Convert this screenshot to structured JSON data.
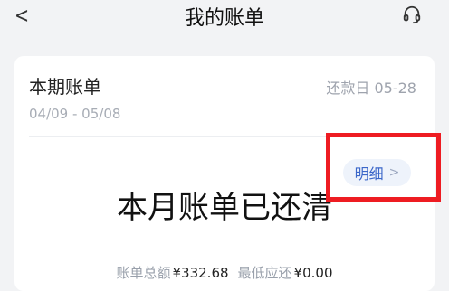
{
  "nav": {
    "title": "我的账单",
    "back_glyph": "<",
    "icons": [
      "chevron-left-icon",
      "headset-icon"
    ]
  },
  "bill": {
    "period_title": "本期账单",
    "due_date_label": "还款日 05-28",
    "period_range": "04/09 - 05/08",
    "detail_label": "明细",
    "detail_chevron": ">",
    "status_text": "本月账单已还清",
    "total_label": "账单总额",
    "total_value": "¥332.68",
    "min_label": "最低应还",
    "min_value": "¥0.00"
  },
  "colors": {
    "background": "#f2f3f5",
    "card": "#ffffff",
    "accent": "#3b67c9",
    "highlight": "#ee1c22"
  }
}
